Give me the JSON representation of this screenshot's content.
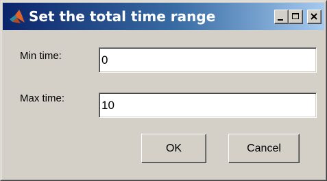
{
  "window": {
    "title": "Set the total time range",
    "app_icon": "matlab-logo-icon",
    "controls": [
      "minimize-icon",
      "maximize-icon",
      "close-icon"
    ]
  },
  "form": {
    "min_label": "Min time:",
    "min_value": "0",
    "max_label": "Max time:",
    "max_value": "10"
  },
  "buttons": {
    "ok_label": "OK",
    "cancel_label": "Cancel"
  },
  "colors": {
    "titlebar_start": "#0a246a",
    "titlebar_end": "#a6caf0",
    "dialog_face": "#d4d0c8"
  }
}
